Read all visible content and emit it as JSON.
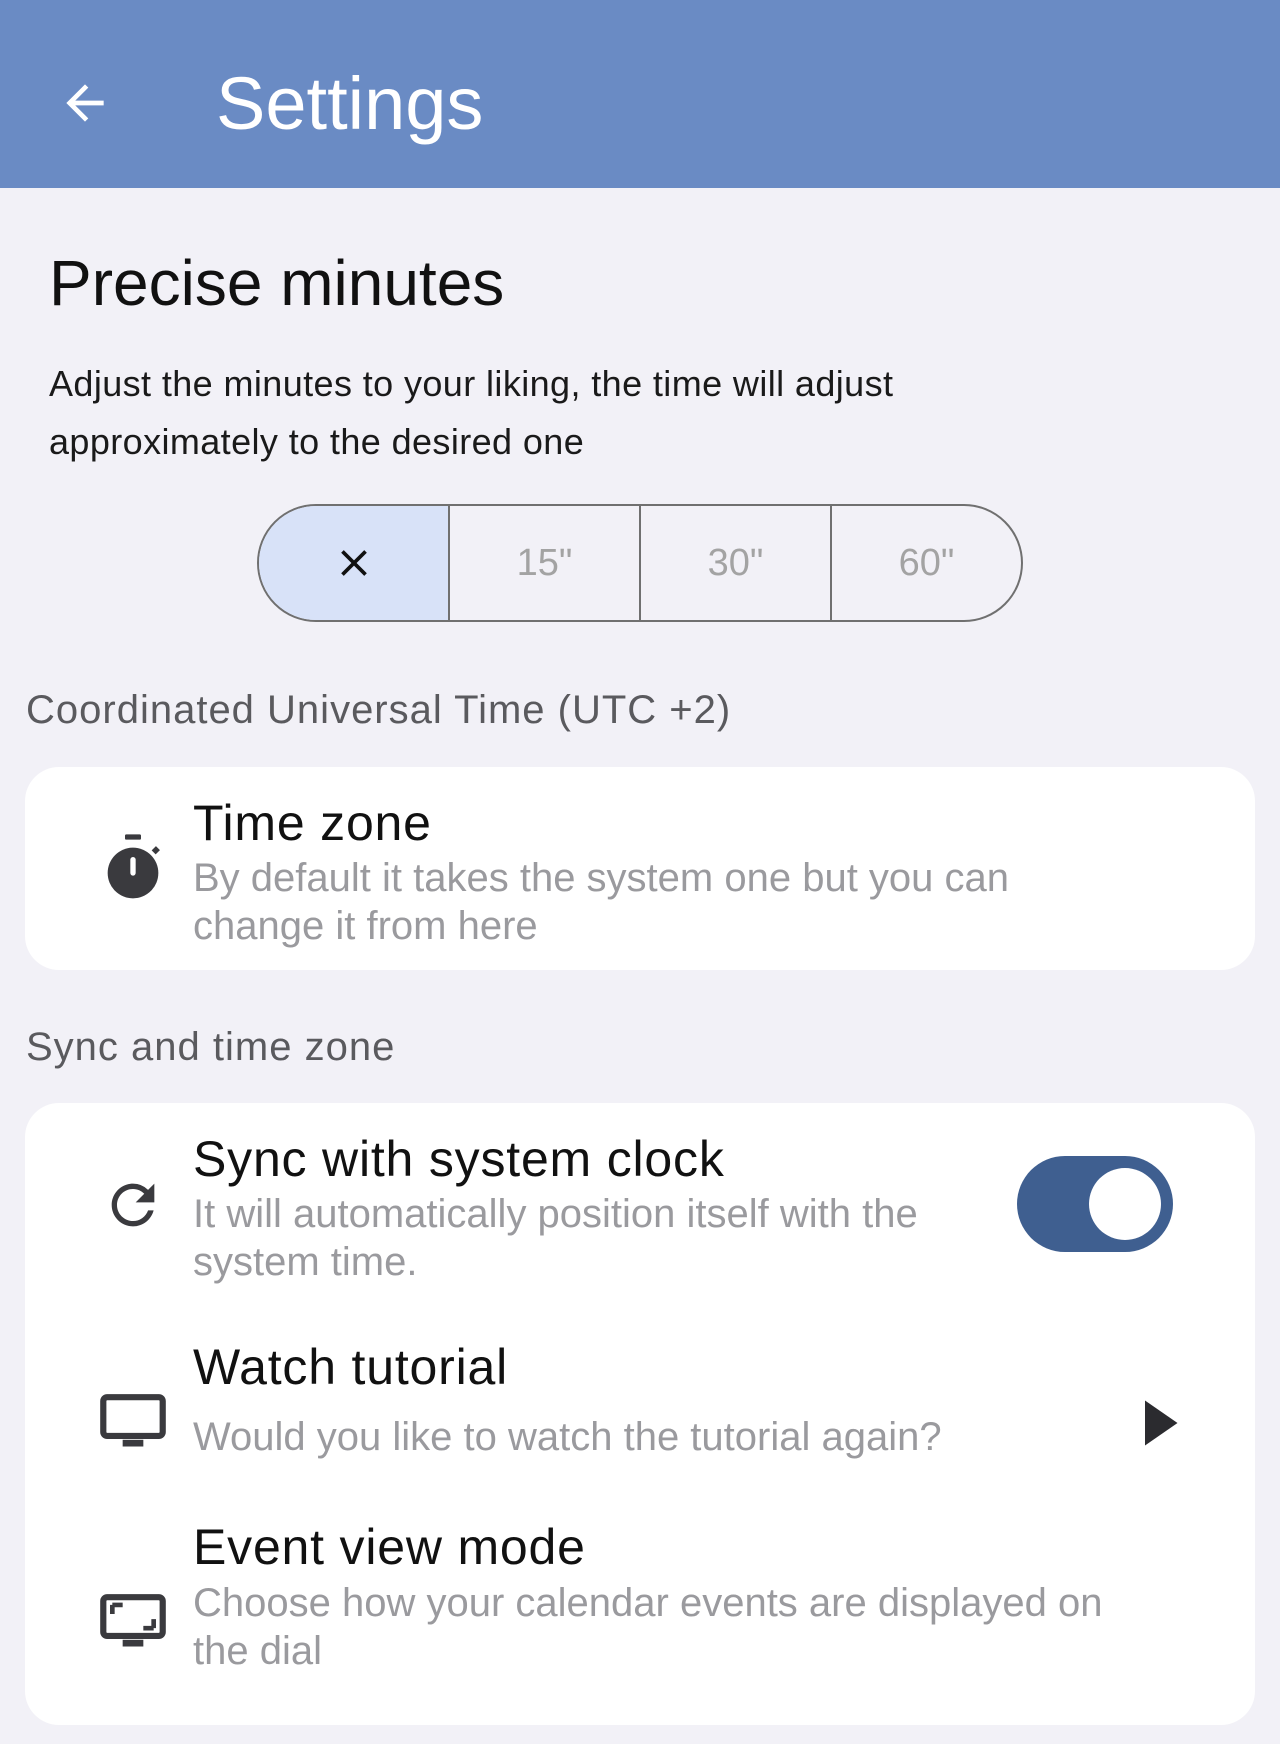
{
  "appbar": {
    "back_icon": "arrow-left-icon",
    "title": "Settings"
  },
  "precise": {
    "title": "Precise minutes",
    "description": "Adjust the minutes to your liking, the time will adjust approximately to the desired one",
    "segments": [
      {
        "label": "",
        "icon": "close-icon",
        "selected": true
      },
      {
        "label": "15\"",
        "selected": false
      },
      {
        "label": "30\"",
        "selected": false
      },
      {
        "label": "60\"",
        "selected": false
      }
    ]
  },
  "utc_group": {
    "label": "Coordinated Universal Time (UTC +2)",
    "items": [
      {
        "icon": "stopwatch-icon",
        "title": "Time zone",
        "subtitle": "By default it takes the system one but you can change it from here"
      }
    ]
  },
  "sync_group": {
    "label": "Sync and time zone",
    "items": [
      {
        "icon": "refresh-icon",
        "title": "Sync with system clock",
        "subtitle": "It will automatically position itself with the system time.",
        "toggle_on": true
      },
      {
        "icon": "monitor-icon",
        "title": "Watch tutorial",
        "subtitle": "Would you like to watch the tutorial again?",
        "trailing_icon": "play-arrow-icon"
      },
      {
        "icon": "fullscreen-monitor-icon",
        "title": "Event view mode",
        "subtitle": "Choose how your calendar events are displayed on the dial"
      }
    ]
  },
  "colors": {
    "appbar": "#6a8bc4",
    "background": "#f2f1f7",
    "toggle_track": "#3f5f90",
    "segment_selected": "#d8e2f8"
  }
}
